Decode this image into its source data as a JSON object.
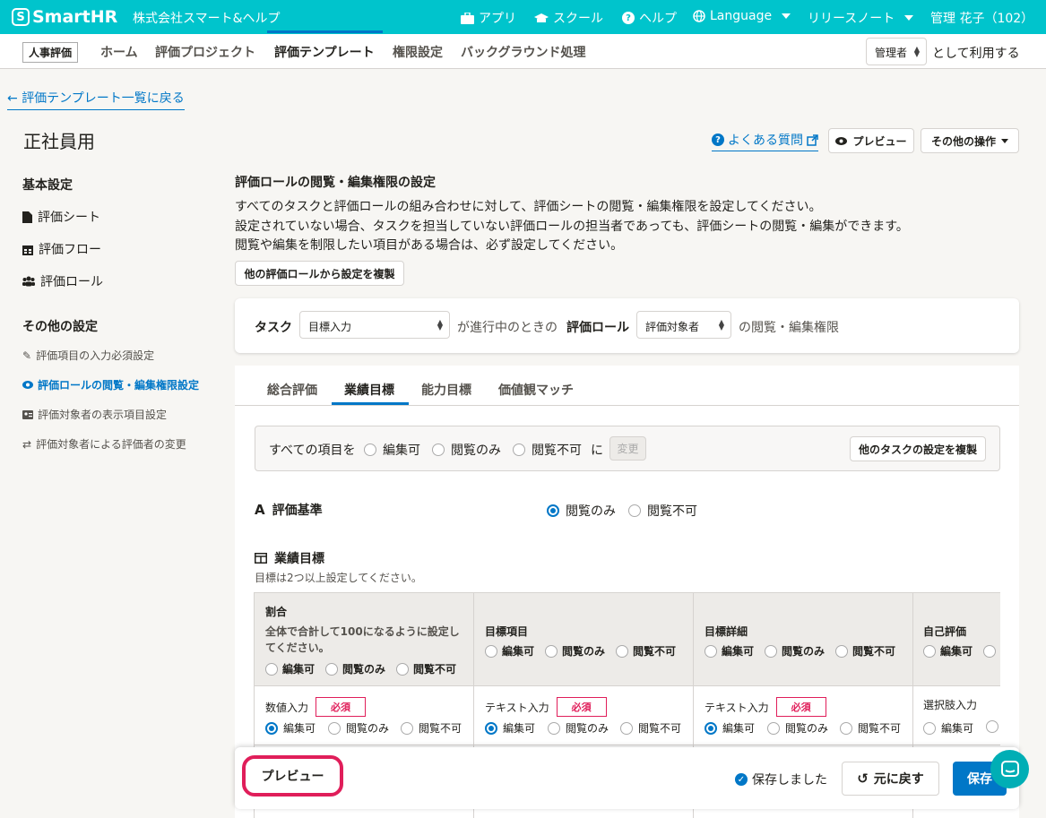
{
  "topbar": {
    "logo": "SmartHR",
    "company": "株式会社スマート&ヘルプ",
    "nav": [
      {
        "label": "アプリ",
        "icon": "briefcase-icon"
      },
      {
        "label": "スクール",
        "icon": "graduation-cap-icon"
      },
      {
        "label": "ヘルプ",
        "icon": "question-circle-icon"
      },
      {
        "label": "Language",
        "icon": "globe-icon"
      },
      {
        "label": "リリースノート"
      },
      {
        "label": "管理 花子（102）"
      }
    ]
  },
  "subnav": {
    "app_badge": "人事評価",
    "items": [
      "ホーム",
      "評価プロジェクト",
      "評価テンプレート",
      "権限設定",
      "バックグラウンド処理"
    ],
    "active": "評価テンプレート",
    "role_value": "管理者",
    "role_suffix": "として利用する"
  },
  "back_link": "評価テンプレート一覧に戻る",
  "page_title": "正社員用",
  "sidebar": {
    "basic_heading": "基本設定",
    "basic_items": [
      {
        "label": "評価シート",
        "icon": "file-icon"
      },
      {
        "label": "評価フロー",
        "icon": "calendar-icon"
      },
      {
        "label": "評価ロール",
        "icon": "users-icon"
      }
    ],
    "other_heading": "その他の設定",
    "other_items": [
      {
        "label": "評価項目の入力必須設定",
        "icon": "pencil-icon"
      },
      {
        "label": "評価ロールの閲覧・編集権限設定",
        "icon": "eye-icon",
        "active": true
      },
      {
        "label": "評価対象者の表示項目設定",
        "icon": "id-card-icon"
      },
      {
        "label": "評価対象者による評価者の変更",
        "icon": "swap-icon"
      }
    ]
  },
  "header_actions": {
    "faq": "よくある質問",
    "preview": "プレビュー",
    "other_ops": "その他の操作"
  },
  "section": {
    "title": "評価ロールの閲覧・編集権限の設定",
    "desc1": "すべてのタスクと評価ロールの組み合わせに対して、評価シートの閲覧・編集権限を設定してください。",
    "desc2": "設定されていない場合、タスクを担当していない評価ロールの担当者であっても、評価シートの閲覧・編集ができます。",
    "desc3": "閲覧や編集を制限したい項目がある場合は、必ず設定してください。",
    "copy_role_button": "他の評価ロールから設定を複製"
  },
  "filter": {
    "task_label": "タスク",
    "task_value": "目標入力",
    "middle_text": "が進行中のときの",
    "role_label": "評価ロール",
    "role_value": "評価対象者",
    "suffix": "の閲覧・編集権限"
  },
  "tabs": [
    "総合評価",
    "業績目標",
    "能力目標",
    "価値観マッチ"
  ],
  "active_tab": "業績目標",
  "bulk": {
    "prefix": "すべての項目を",
    "options": [
      "編集可",
      "閲覧のみ",
      "閲覧不可"
    ],
    "ni": "に",
    "change_button": "変更",
    "copy_task_button": "他のタスクの設定を複製"
  },
  "criteria": {
    "title": "評価基準",
    "options": [
      "閲覧のみ",
      "閲覧不可"
    ],
    "selected": "閲覧のみ"
  },
  "goals": {
    "title": "業績目標",
    "note": "目標は2つ以上設定してください。",
    "columns": [
      {
        "title": "割合",
        "sub": "全体で合計して100になるように設定してください。",
        "type": "数値入力",
        "required": true
      },
      {
        "title": "目標項目",
        "sub": "",
        "type": "テキスト入力",
        "required": true
      },
      {
        "title": "目標詳細",
        "sub": "",
        "type": "テキスト入力",
        "required": true
      },
      {
        "title": "自己評価",
        "sub": "",
        "type": "選択肢入力",
        "required": false
      }
    ],
    "perm_options": [
      "編集可",
      "閲覧のみ",
      "閲覧不可"
    ],
    "required_label": "必須"
  },
  "footer": {
    "preview": "プレビュー",
    "saved": "保存しました",
    "undo": "元に戻す",
    "save": "保存"
  },
  "colors": {
    "topbar": "#00c4cc",
    "accent": "#0077c7",
    "required": "#e01e5a"
  }
}
